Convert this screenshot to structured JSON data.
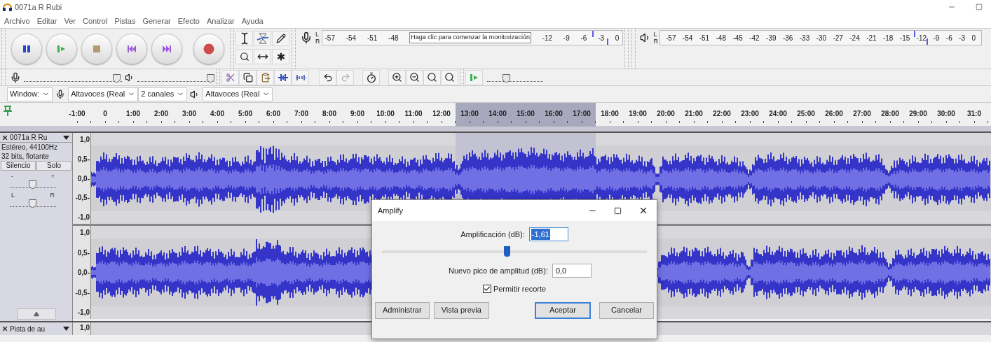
{
  "window": {
    "title": "0071a R Rubi"
  },
  "menu": [
    "Archivo",
    "Editar",
    "Ver",
    "Control",
    "Pistas",
    "Generar",
    "Efecto",
    "Analizar",
    "Ayuda"
  ],
  "record_meter": {
    "left": "L",
    "right": "R",
    "ticks_before": [
      "-57",
      "-54",
      "-51",
      "-48"
    ],
    "tooltip": "Haga clic para comenzar la monitorización",
    "ticks_after": [
      "-12",
      "-9",
      "-6",
      "-3",
      "0"
    ],
    "peaks": [
      {
        "level": 0.9
      },
      {
        "level": 0.95
      }
    ]
  },
  "play_meter": {
    "left": "L",
    "right": "R",
    "ticks": [
      "-57",
      "-54",
      "-51",
      "-48",
      "-45",
      "-42",
      "-39",
      "-36",
      "-33",
      "-30",
      "-27",
      "-24",
      "-21",
      "-18",
      "-15",
      "-12",
      "-9",
      "-6",
      "-3",
      "0"
    ],
    "peaks": [
      {
        "level": 0.79
      },
      {
        "level": 0.83
      }
    ]
  },
  "mixer": {
    "record_volume": {
      "level": 0.95
    },
    "play_volume": {
      "level": 0.95
    }
  },
  "play_at_speed": {
    "level": 0.35
  },
  "devices": [
    {
      "kind": "host",
      "value": "Window:"
    },
    {
      "kind": "mic",
      "value": "Altavoces (Real"
    },
    {
      "kind": "plain",
      "value": "2 canales"
    },
    {
      "kind": "speaker",
      "value": "Altavoces (Real"
    }
  ],
  "timeline": [
    {
      "label": "-1:00",
      "selected": false
    },
    {
      "label": "0",
      "selected": false
    },
    {
      "label": "1:00",
      "selected": false
    },
    {
      "label": "2:00",
      "selected": false
    },
    {
      "label": "3:00",
      "selected": false
    },
    {
      "label": "4:00",
      "selected": false
    },
    {
      "label": "5:00",
      "selected": false
    },
    {
      "label": "6:00",
      "selected": false
    },
    {
      "label": "7:00",
      "selected": false
    },
    {
      "label": "8:00",
      "selected": false
    },
    {
      "label": "9:00",
      "selected": false
    },
    {
      "label": "10:00",
      "selected": false
    },
    {
      "label": "11:00",
      "selected": false
    },
    {
      "label": "12:00",
      "selected": false
    },
    {
      "label": "13:00",
      "selected": true
    },
    {
      "label": "14:00",
      "selected": true
    },
    {
      "label": "15:00",
      "selected": true
    },
    {
      "label": "16:00",
      "selected": true
    },
    {
      "label": "17:00",
      "selected": true
    },
    {
      "label": "18:00",
      "selected": false
    },
    {
      "label": "19:00",
      "selected": false
    },
    {
      "label": "20:00",
      "selected": false
    },
    {
      "label": "21:00",
      "selected": false
    },
    {
      "label": "22:00",
      "selected": false
    },
    {
      "label": "23:00",
      "selected": false
    },
    {
      "label": "24:00",
      "selected": false
    },
    {
      "label": "25:00",
      "selected": false
    },
    {
      "label": "26:00",
      "selected": false
    },
    {
      "label": "27:00",
      "selected": false
    },
    {
      "label": "28:00",
      "selected": false
    },
    {
      "label": "29:00",
      "selected": false
    },
    {
      "label": "30:00",
      "selected": false
    },
    {
      "label": "31:0",
      "selected": false
    }
  ],
  "tracks": [
    {
      "name": "0071a R Ru",
      "info": [
        "Estéreo, 44100Hz",
        "32 bits, flotante"
      ],
      "buttons": [
        "Silencio",
        "Solo"
      ],
      "gain": {
        "minus": "-",
        "plus": "+",
        "level": 0.5
      },
      "pan": {
        "left": "L",
        "right": "R",
        "level": 0.5
      },
      "channels": [
        {
          "ruler": [
            "1,0",
            "0,5-",
            "0,0-",
            "-0,5-",
            "-1,0"
          ]
        },
        {
          "ruler": [
            "1,0",
            "0,5-",
            "0,0-",
            "-0,5-",
            "-1,0"
          ]
        }
      ]
    },
    {
      "name": "Pista de au",
      "ruler": [
        "1,0"
      ]
    }
  ],
  "dialog": {
    "title": "Amplify",
    "amp_label": "Amplificación (dB):",
    "amp_value": "-1,61",
    "slider": {
      "level": 0.47
    },
    "peak_label": "Nuevo pico de amplitud (dB):",
    "peak_value": "0,0",
    "clip": {
      "label": "Permitir recorte",
      "checked": true
    },
    "buttons": [
      {
        "label": "Administrar",
        "default": false
      },
      {
        "label": "Vista previa",
        "default": false
      },
      {
        "label": "Aceptar",
        "default": true
      },
      {
        "label": "Cancelar",
        "default": false
      }
    ]
  }
}
